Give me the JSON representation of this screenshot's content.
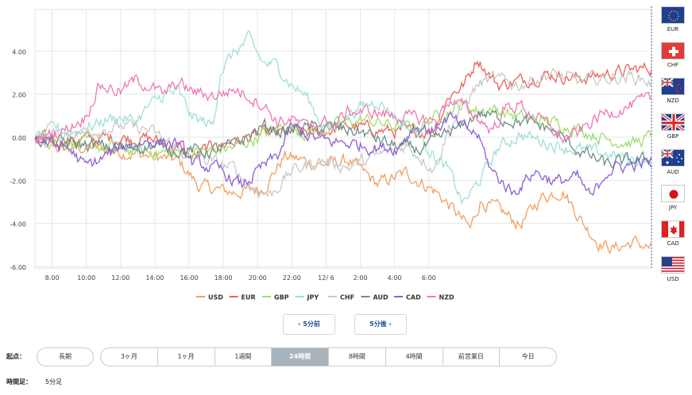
{
  "chart_data": {
    "type": "line",
    "ylim": [
      -6,
      6
    ],
    "y_ticks": [
      "4.00",
      "2.00",
      "0.00",
      "-2.00",
      "-4.00",
      "-6.00"
    ],
    "y_tick_values": [
      4,
      2,
      0,
      -2,
      -4,
      -6
    ],
    "x_ticks": [
      "8:00",
      "10:00",
      "12:00",
      "14:00",
      "16:00",
      "18:00",
      "20:00",
      "22:00",
      "12/ 6",
      "2:00",
      "4:00",
      "6:00"
    ],
    "x_start": "7:00",
    "x_end": "7:05",
    "x_step": "0:05",
    "grid": true,
    "legend_position": "bottom",
    "series": [
      {
        "name": "USD",
        "color": "#f0a060",
        "keypoints": [
          [
            0,
            0
          ],
          [
            20,
            -0.5
          ],
          [
            40,
            -0.4
          ],
          [
            60,
            -0.6
          ],
          [
            80,
            -0.8
          ],
          [
            100,
            -1.0
          ],
          [
            115,
            -2.2
          ],
          [
            140,
            -2.5
          ],
          [
            160,
            -2.3
          ],
          [
            175,
            -0.8
          ],
          [
            200,
            -1.2
          ],
          [
            220,
            -1.0
          ],
          [
            240,
            -2.1
          ],
          [
            260,
            -1.6
          ],
          [
            280,
            -2.4
          ],
          [
            292,
            -3.2
          ],
          [
            305,
            -4.2
          ],
          [
            312,
            -2.9
          ],
          [
            325,
            -3.3
          ],
          [
            340,
            -4.0
          ],
          [
            355,
            -2.7
          ],
          [
            370,
            -2.4
          ],
          [
            385,
            -4.0
          ],
          [
            395,
            -4.8
          ],
          [
            405,
            -5.1
          ],
          [
            420,
            -4.8
          ],
          [
            432,
            -5.1
          ]
        ]
      },
      {
        "name": "EUR",
        "color": "#e8635a",
        "keypoints": [
          [
            0,
            0
          ],
          [
            15,
            -0.1
          ],
          [
            40,
            0
          ],
          [
            60,
            0.05
          ],
          [
            80,
            0
          ],
          [
            100,
            -0.4
          ],
          [
            110,
            -0.9
          ],
          [
            120,
            -0.5
          ],
          [
            135,
            -0.2
          ],
          [
            160,
            0.2
          ],
          [
            180,
            0.3
          ],
          [
            200,
            0.3
          ],
          [
            220,
            0.6
          ],
          [
            240,
            0.4
          ],
          [
            260,
            0.3
          ],
          [
            280,
            0.4
          ],
          [
            290,
            2.0
          ],
          [
            300,
            2.5
          ],
          [
            305,
            3.0
          ],
          [
            310,
            3.8
          ],
          [
            318,
            3.0
          ],
          [
            325,
            2.5
          ],
          [
            340,
            2.7
          ],
          [
            360,
            3.0
          ],
          [
            380,
            2.8
          ],
          [
            400,
            3.0
          ],
          [
            420,
            3.2
          ],
          [
            432,
            3.3
          ]
        ]
      },
      {
        "name": "GBP",
        "color": "#9de06c",
        "keypoints": [
          [
            0,
            0
          ],
          [
            20,
            -0.1
          ],
          [
            40,
            -0.3
          ],
          [
            60,
            -0.5
          ],
          [
            80,
            -0.6
          ],
          [
            100,
            -0.7
          ],
          [
            120,
            -0.6
          ],
          [
            140,
            -0.4
          ],
          [
            160,
            0.2
          ],
          [
            175,
            0.6
          ],
          [
            190,
            0.3
          ],
          [
            210,
            0.6
          ],
          [
            230,
            0.9
          ],
          [
            250,
            0.6
          ],
          [
            265,
            0.5
          ],
          [
            280,
            1.0
          ],
          [
            290,
            1.3
          ],
          [
            300,
            1.6
          ],
          [
            310,
            1.3
          ],
          [
            320,
            1.4
          ],
          [
            340,
            1.0
          ],
          [
            360,
            0.8
          ],
          [
            380,
            0.5
          ],
          [
            400,
            0.0
          ],
          [
            420,
            -0.2
          ],
          [
            432,
            0.1
          ]
        ]
      },
      {
        "name": "JPY",
        "color": "#9fe0d8",
        "keypoints": [
          [
            0,
            0
          ],
          [
            15,
            0.5
          ],
          [
            25,
            0.3
          ],
          [
            40,
            0.6
          ],
          [
            50,
            0.9
          ],
          [
            60,
            1.0
          ],
          [
            70,
            0.8
          ],
          [
            80,
            1.5
          ],
          [
            90,
            2.0
          ],
          [
            100,
            2.2
          ],
          [
            110,
            1.0
          ],
          [
            125,
            0.6
          ],
          [
            130,
            3.2
          ],
          [
            140,
            4.0
          ],
          [
            150,
            4.6
          ],
          [
            160,
            3.5
          ],
          [
            170,
            3.4
          ],
          [
            180,
            2.5
          ],
          [
            190,
            2.0
          ],
          [
            200,
            0.8
          ],
          [
            210,
            0.4
          ],
          [
            220,
            1.2
          ],
          [
            230,
            1.5
          ],
          [
            240,
            1.8
          ],
          [
            250,
            1.2
          ],
          [
            260,
            0.6
          ],
          [
            270,
            0.2
          ],
          [
            280,
            -0.8
          ],
          [
            290,
            -1.5
          ],
          [
            300,
            -3.0
          ],
          [
            310,
            -2.1
          ],
          [
            325,
            -0.4
          ],
          [
            340,
            0.2
          ],
          [
            360,
            -0.2
          ],
          [
            380,
            -0.5
          ],
          [
            400,
            -0.7
          ],
          [
            420,
            -1.0
          ],
          [
            432,
            -1.0
          ]
        ]
      },
      {
        "name": "CHF",
        "color": "#c8c8c8",
        "keypoints": [
          [
            0,
            0
          ],
          [
            20,
            0.2
          ],
          [
            40,
            0.4
          ],
          [
            60,
            0.6
          ],
          [
            80,
            0.4
          ],
          [
            100,
            -0.5
          ],
          [
            120,
            -1.0
          ],
          [
            140,
            -1.4
          ],
          [
            150,
            -2.2
          ],
          [
            165,
            -2.6
          ],
          [
            180,
            -1.5
          ],
          [
            200,
            -1.0
          ],
          [
            220,
            -1.3
          ],
          [
            240,
            -0.8
          ],
          [
            260,
            -0.3
          ],
          [
            270,
            -0.8
          ],
          [
            280,
            -1.4
          ],
          [
            290,
            0.5
          ],
          [
            300,
            1.5
          ],
          [
            310,
            2.5
          ],
          [
            320,
            2.8
          ],
          [
            340,
            2.5
          ],
          [
            360,
            3.0
          ],
          [
            380,
            2.7
          ],
          [
            400,
            2.8
          ],
          [
            420,
            2.9
          ],
          [
            432,
            2.6
          ]
        ]
      },
      {
        "name": "AUD",
        "color": "#6d8f86",
        "keypoints": [
          [
            0,
            0
          ],
          [
            20,
            -0.2
          ],
          [
            40,
            -0.3
          ],
          [
            60,
            -0.5
          ],
          [
            80,
            -0.3
          ],
          [
            100,
            -0.5
          ],
          [
            120,
            -0.6
          ],
          [
            140,
            -0.3
          ],
          [
            160,
            0.6
          ],
          [
            175,
            0.3
          ],
          [
            190,
            0.5
          ],
          [
            210,
            0.5
          ],
          [
            230,
            0.3
          ],
          [
            250,
            -0.3
          ],
          [
            270,
            -0.5
          ],
          [
            280,
            -0.2
          ],
          [
            290,
            0.3
          ],
          [
            300,
            0.5
          ],
          [
            310,
            1.2
          ],
          [
            325,
            1.0
          ],
          [
            340,
            0.8
          ],
          [
            360,
            0.5
          ],
          [
            380,
            -0.5
          ],
          [
            400,
            -1.2
          ],
          [
            420,
            -1.0
          ],
          [
            432,
            -1.0
          ]
        ]
      },
      {
        "name": "CAD",
        "color": "#8a61d4",
        "keypoints": [
          [
            0,
            0
          ],
          [
            15,
            -0.3
          ],
          [
            25,
            -0.5
          ],
          [
            35,
            -1.3
          ],
          [
            45,
            -1.0
          ],
          [
            60,
            -0.4
          ],
          [
            80,
            -0.1
          ],
          [
            100,
            -0.2
          ],
          [
            110,
            -1.1
          ],
          [
            130,
            -1.5
          ],
          [
            145,
            -2.2
          ],
          [
            160,
            -1.3
          ],
          [
            170,
            -0.8
          ],
          [
            180,
            0.6
          ],
          [
            190,
            0.2
          ],
          [
            200,
            -0.1
          ],
          [
            220,
            -0.2
          ],
          [
            240,
            -0.4
          ],
          [
            255,
            -0.4
          ],
          [
            265,
            0.6
          ],
          [
            280,
            0.4
          ],
          [
            290,
            1.0
          ],
          [
            300,
            0.5
          ],
          [
            310,
            0.2
          ],
          [
            320,
            -1.5
          ],
          [
            335,
            -2.5
          ],
          [
            350,
            -1.5
          ],
          [
            365,
            -2.0
          ],
          [
            380,
            -1.8
          ],
          [
            390,
            -2.8
          ],
          [
            400,
            -1.5
          ],
          [
            410,
            -1.3
          ],
          [
            420,
            -1.2
          ],
          [
            432,
            -1.1
          ]
        ]
      },
      {
        "name": "NZD",
        "color": "#ef78b4",
        "keypoints": [
          [
            0,
            0
          ],
          [
            20,
            0.4
          ],
          [
            35,
            1.0
          ],
          [
            45,
            2.5
          ],
          [
            60,
            2.2
          ],
          [
            70,
            2.7
          ],
          [
            80,
            2.5
          ],
          [
            90,
            2.0
          ],
          [
            100,
            2.6
          ],
          [
            110,
            2.2
          ],
          [
            125,
            2.0
          ],
          [
            140,
            2.3
          ],
          [
            150,
            2.0
          ],
          [
            160,
            1.6
          ],
          [
            170,
            0.8
          ],
          [
            180,
            0.9
          ],
          [
            190,
            0.5
          ],
          [
            200,
            0.8
          ],
          [
            210,
            0.6
          ],
          [
            220,
            1.3
          ],
          [
            240,
            1.2
          ],
          [
            260,
            1.0
          ],
          [
            280,
            0.8
          ],
          [
            290,
            1.8
          ],
          [
            300,
            1.5
          ],
          [
            310,
            1.0
          ],
          [
            320,
            0.4
          ],
          [
            330,
            1.4
          ],
          [
            340,
            1.6
          ],
          [
            350,
            1.0
          ],
          [
            360,
            0.6
          ],
          [
            370,
            0.0
          ],
          [
            380,
            0.2
          ],
          [
            390,
            0.8
          ],
          [
            400,
            1.2
          ],
          [
            410,
            1.4
          ],
          [
            420,
            1.6
          ],
          [
            432,
            1.8
          ]
        ]
      }
    ]
  },
  "flags": [
    {
      "code": "EUR",
      "name": "eur-flag-icon"
    },
    {
      "code": "CHF",
      "name": "chf-flag-icon"
    },
    {
      "code": "NZD",
      "name": "nzd-flag-icon"
    },
    {
      "code": "GBP",
      "name": "gbp-flag-icon"
    },
    {
      "code": "AUD",
      "name": "aud-flag-icon"
    },
    {
      "code": "JPY",
      "name": "jpy-flag-icon"
    },
    {
      "code": "CAD",
      "name": "cad-flag-icon"
    },
    {
      "code": "USD",
      "name": "usd-flag-icon"
    }
  ],
  "nav": {
    "prev_label": "‹ 5分前",
    "next_label": "5分後 ›"
  },
  "controls": {
    "start_label": "起点：",
    "start_long": "長期",
    "periods": [
      "3ヶ月",
      "1ヶ月",
      "1週間",
      "24時間",
      "8時間",
      "4時間",
      "前営業日",
      "今日"
    ],
    "active_period": "24時間",
    "interval_label": "時間足：",
    "interval_value": "5分足"
  }
}
